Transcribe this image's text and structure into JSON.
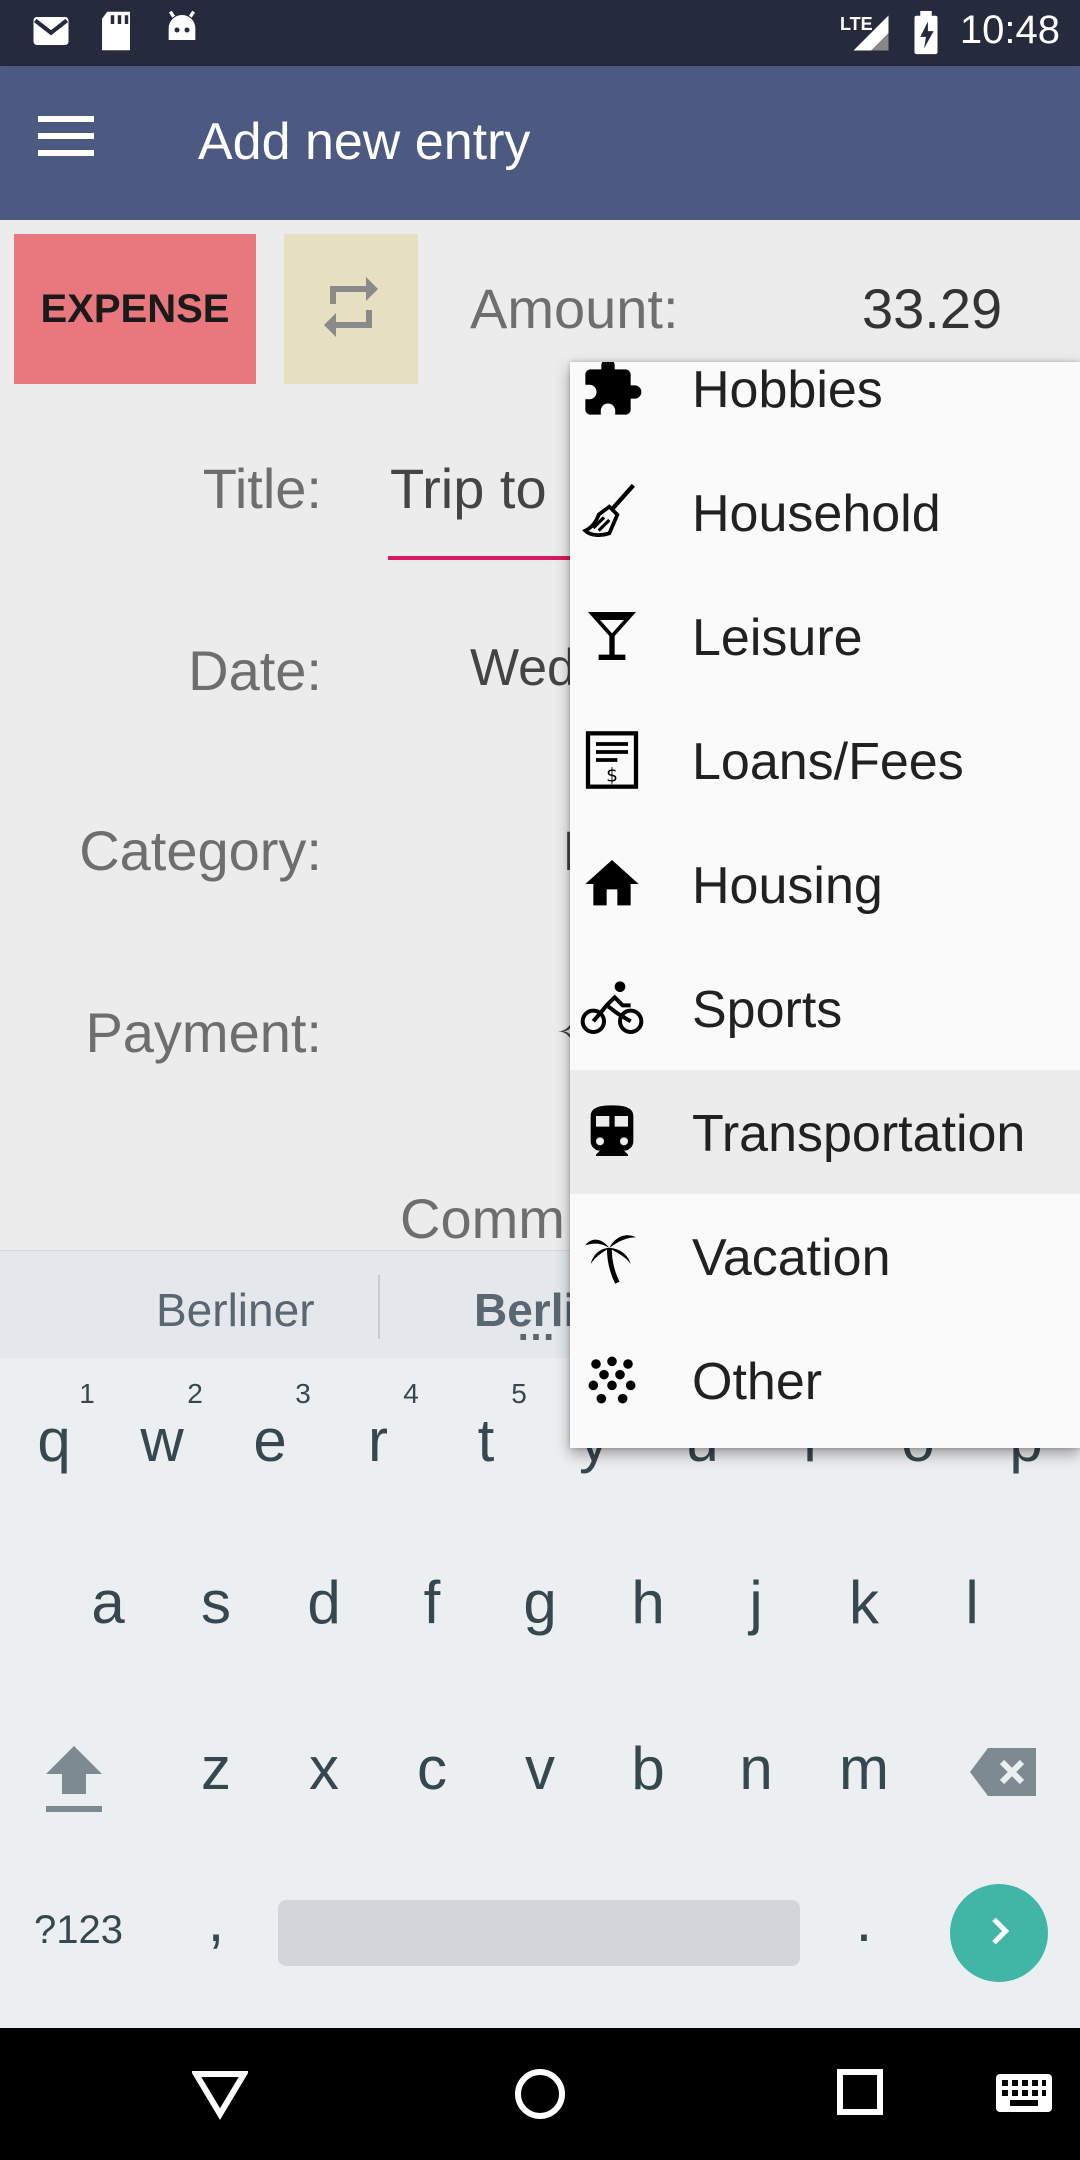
{
  "status_bar": {
    "time": "10:48",
    "network": "LTE"
  },
  "app_bar": {
    "title": "Add new entry"
  },
  "form": {
    "type_button": "EXPENSE",
    "amount_label": "Amount:",
    "amount_value": "33.29",
    "title_label": "Title:",
    "title_value": "Trip to",
    "date_label": "Date:",
    "date_value": "Wed",
    "category_label": "Category:",
    "category_value": "I",
    "payment_label": "Payment:",
    "comment_label": "Comm"
  },
  "dropdown": {
    "items": [
      {
        "label": "Hobbies",
        "icon": "puzzle-icon"
      },
      {
        "label": "Household",
        "icon": "broom-icon"
      },
      {
        "label": "Leisure",
        "icon": "cocktail-icon"
      },
      {
        "label": "Loans/Fees",
        "icon": "bill-icon"
      },
      {
        "label": "Housing",
        "icon": "home-icon"
      },
      {
        "label": "Sports",
        "icon": "bicycle-icon"
      },
      {
        "label": "Transportation",
        "icon": "train-icon",
        "selected": true
      },
      {
        "label": "Vacation",
        "icon": "palm-tree-icon"
      },
      {
        "label": "Other",
        "icon": "dots-icon"
      }
    ]
  },
  "keyboard": {
    "suggestions": [
      "Berliner",
      "Berli"
    ],
    "row1": [
      "q",
      "w",
      "e",
      "r",
      "t",
      "y",
      "u",
      "i",
      "o",
      "p"
    ],
    "row1_hints": [
      "1",
      "2",
      "3",
      "4",
      "5"
    ],
    "row2": [
      "a",
      "s",
      "d",
      "f",
      "g",
      "h",
      "j",
      "k",
      "l"
    ],
    "row3": [
      "z",
      "x",
      "c",
      "v",
      "b",
      "n",
      "m"
    ],
    "symbols_key": "?123",
    "comma_key": ",",
    "period_key": "."
  },
  "colors": {
    "app_bar": "#4c5a82",
    "status_bar": "#252a3d",
    "expense": "#e8787e",
    "accent": "#d81b60",
    "enter": "#41b5a6"
  }
}
